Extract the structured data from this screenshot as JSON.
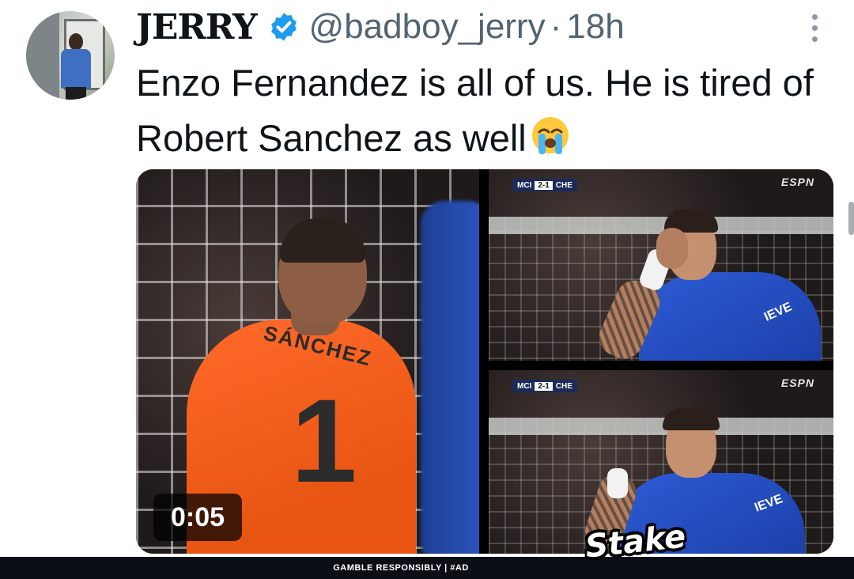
{
  "author": {
    "display_name": "JERRY",
    "handle": "@badboy_jerry",
    "separator": "·",
    "time": "18h",
    "verified": true,
    "verified_color": "#1d9bf0",
    "avatar_icon": "avatar-photo"
  },
  "tweet": {
    "text": "Enzo Fernandez is all of us. He is tired of Robert Sanchez as well",
    "emoji": "loudly-crying-face-icon"
  },
  "media": {
    "video_duration": "0:05",
    "jersey_name": "SÁNCHEZ",
    "jersey_number": "1",
    "scorebug_top": {
      "home": "MCI",
      "score": "2-1",
      "away": "CHE"
    },
    "scorebug_bottom": {
      "home": "MCI",
      "score": "2-1",
      "away": "CHE"
    },
    "broadcaster_top": "ESPN",
    "broadcaster_bottom": "ESPN",
    "shirt_sponsor": "IEVE"
  },
  "promo": {
    "text": "GAMBLE RESPONSIBLY  |  #AD",
    "logo": "Stake"
  },
  "menu": {
    "icon": "more-vertical-icon"
  }
}
